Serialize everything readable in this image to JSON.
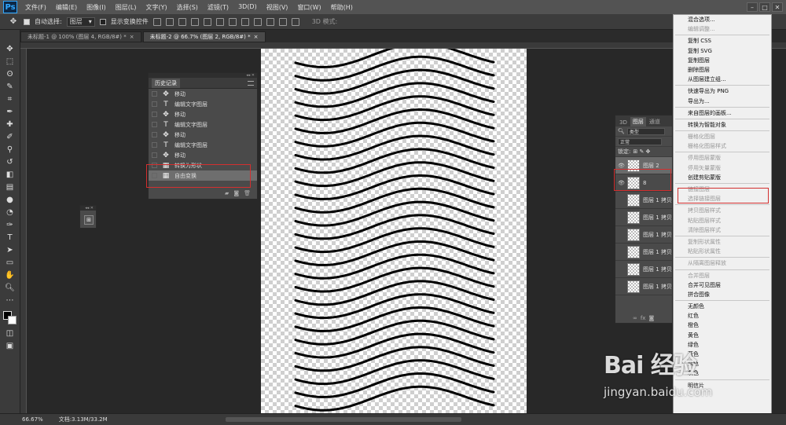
{
  "app": {
    "logo": "Ps"
  },
  "menubar": {
    "items": [
      "文件(F)",
      "编辑(E)",
      "图像(I)",
      "图层(L)",
      "文字(Y)",
      "选择(S)",
      "滤镜(T)",
      "3D(D)",
      "视图(V)",
      "窗口(W)",
      "帮助(H)"
    ]
  },
  "options": {
    "auto_select": "自动选择:",
    "auto_select_value": "图层",
    "show_transform": "显示变换控件",
    "mode_3d": "3D 模式:"
  },
  "tabs": [
    {
      "label": "未标题-1 @ 100% (图层 4, RGB/8#) *",
      "active": false
    },
    {
      "label": "未标题-2 @ 66.7% (图层 2, RGB/8#) *",
      "active": true
    }
  ],
  "history": {
    "title": "历史记录",
    "items": [
      {
        "icon": "move",
        "label": "移动"
      },
      {
        "icon": "text",
        "label": "编辑文字图层"
      },
      {
        "icon": "move",
        "label": "移动"
      },
      {
        "icon": "text",
        "label": "编辑文字图层"
      },
      {
        "icon": "move",
        "label": "移动"
      },
      {
        "icon": "text",
        "label": "编辑文字图层"
      },
      {
        "icon": "move",
        "label": "移动"
      },
      {
        "icon": "shape",
        "label": "转换为形状"
      },
      {
        "icon": "shape",
        "label": "自由变换"
      }
    ]
  },
  "layers_panel": {
    "tabs": [
      "3D",
      "图层",
      "通道"
    ],
    "filter": "类型",
    "blend": "正常",
    "lock": "锁定:",
    "layers": [
      "图层 2",
      "8",
      "图层 1 拷贝",
      "图层 1 拷贝",
      "图层 1 拷贝",
      "图层 1 拷贝",
      "图层 1 拷贝",
      "图层 1 拷贝"
    ],
    "footer": [
      "fx"
    ]
  },
  "context_menu": {
    "sections": [
      [
        {
          "label": "混合选项...",
          "disabled": false
        },
        {
          "label": "编辑调整...",
          "disabled": true
        }
      ],
      [
        {
          "label": "复制 CSS",
          "disabled": false
        },
        {
          "label": "复制 SVG",
          "disabled": false
        },
        {
          "label": "复制图层",
          "disabled": false
        },
        {
          "label": "删除图层",
          "disabled": false
        },
        {
          "label": "从图层建立组...",
          "disabled": false
        }
      ],
      [
        {
          "label": "快速导出为 PNG",
          "disabled": false
        },
        {
          "label": "导出为...",
          "disabled": false
        }
      ],
      [
        {
          "label": "来自图层的画板...",
          "disabled": false
        }
      ],
      [
        {
          "label": "转换为智能对象",
          "disabled": false
        }
      ],
      [
        {
          "label": "栅格化图层",
          "disabled": true
        },
        {
          "label": "栅格化图层样式",
          "disabled": true
        }
      ],
      [
        {
          "label": "停用图层蒙版",
          "disabled": true
        },
        {
          "label": "停用矢量蒙版",
          "disabled": true
        },
        {
          "label": "创建剪贴蒙版",
          "disabled": false
        }
      ],
      [
        {
          "label": "链接图层",
          "disabled": true
        },
        {
          "label": "选择链接图层",
          "disabled": true
        }
      ],
      [
        {
          "label": "拷贝图层样式",
          "disabled": true
        },
        {
          "label": "粘贴图层样式",
          "disabled": true
        },
        {
          "label": "清除图层样式",
          "disabled": true
        }
      ],
      [
        {
          "label": "复制形状属性",
          "disabled": true
        },
        {
          "label": "粘贴形状属性",
          "disabled": true
        }
      ],
      [
        {
          "label": "从隔离图层释放",
          "disabled": true
        }
      ],
      [
        {
          "label": "合并图层",
          "disabled": true
        },
        {
          "label": "合并可见图层",
          "disabled": false
        },
        {
          "label": "拼合图像",
          "disabled": false
        }
      ],
      [
        {
          "label": "无颜色",
          "disabled": false
        },
        {
          "label": "红色",
          "disabled": false
        },
        {
          "label": "橙色",
          "disabled": false
        },
        {
          "label": "黄色",
          "disabled": false
        },
        {
          "label": "绿色",
          "disabled": false
        },
        {
          "label": "蓝色",
          "disabled": false
        },
        {
          "label": "紫色",
          "disabled": false
        },
        {
          "label": "灰色",
          "disabled": false
        }
      ],
      [
        {
          "label": "明信片",
          "disabled": false
        }
      ]
    ]
  },
  "status": {
    "zoom": "66.67%",
    "doc": "文档:3.13M/33.2M"
  },
  "watermark": {
    "logo": "Bai 经验",
    "url": "jingyan.baidu.com"
  },
  "colors": {
    "accent_red": "#d32f2f",
    "ps_blue": "#31a8ff"
  }
}
